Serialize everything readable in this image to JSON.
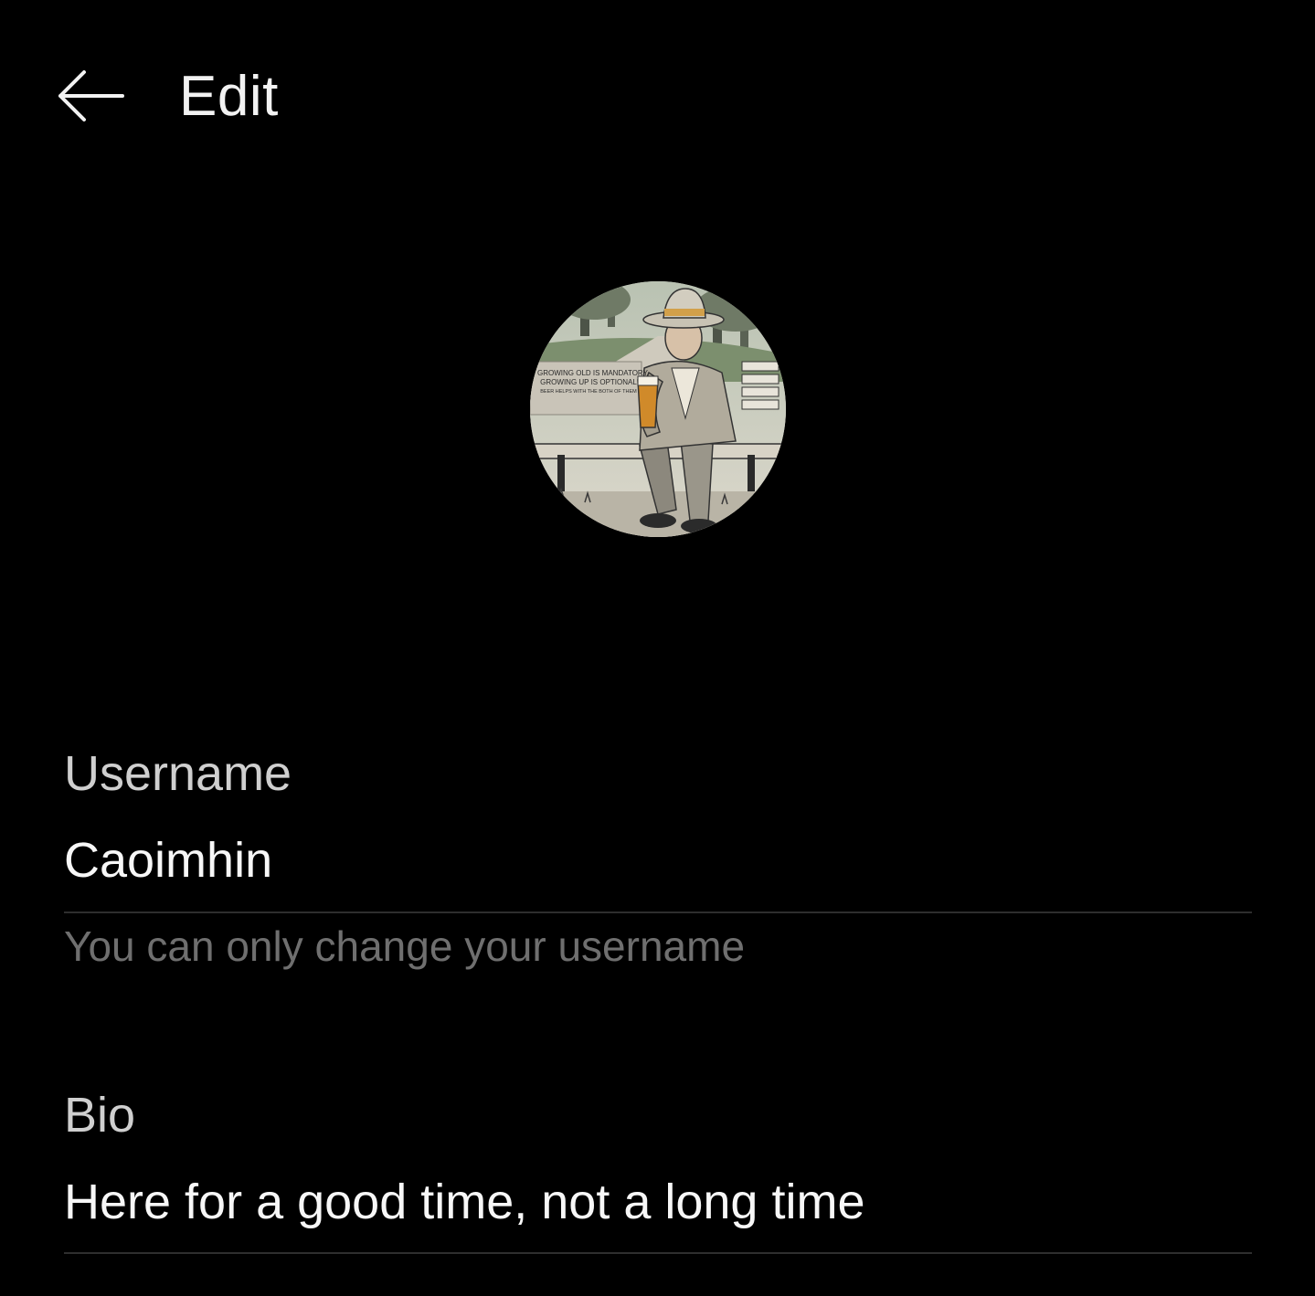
{
  "header": {
    "title": "Edit",
    "back_icon": "arrow-left-icon"
  },
  "avatar": {
    "sign_lines": [
      "GROWING OLD IS MANDATORY,",
      "GROWING UP IS OPTIONAL",
      "BEER HELPS WITH THE BOTH OF THEM"
    ]
  },
  "username": {
    "label": "Username",
    "value": "Caoimhin",
    "hint": "You can only change your username"
  },
  "bio": {
    "label": "Bio",
    "value": "Here for a good time, not a long time"
  },
  "colors": {
    "background": "#000000",
    "text": "#f2f2f2",
    "label": "#cfcfcf",
    "hint": "#6f6f6f",
    "divider": "#2e2e2e"
  }
}
